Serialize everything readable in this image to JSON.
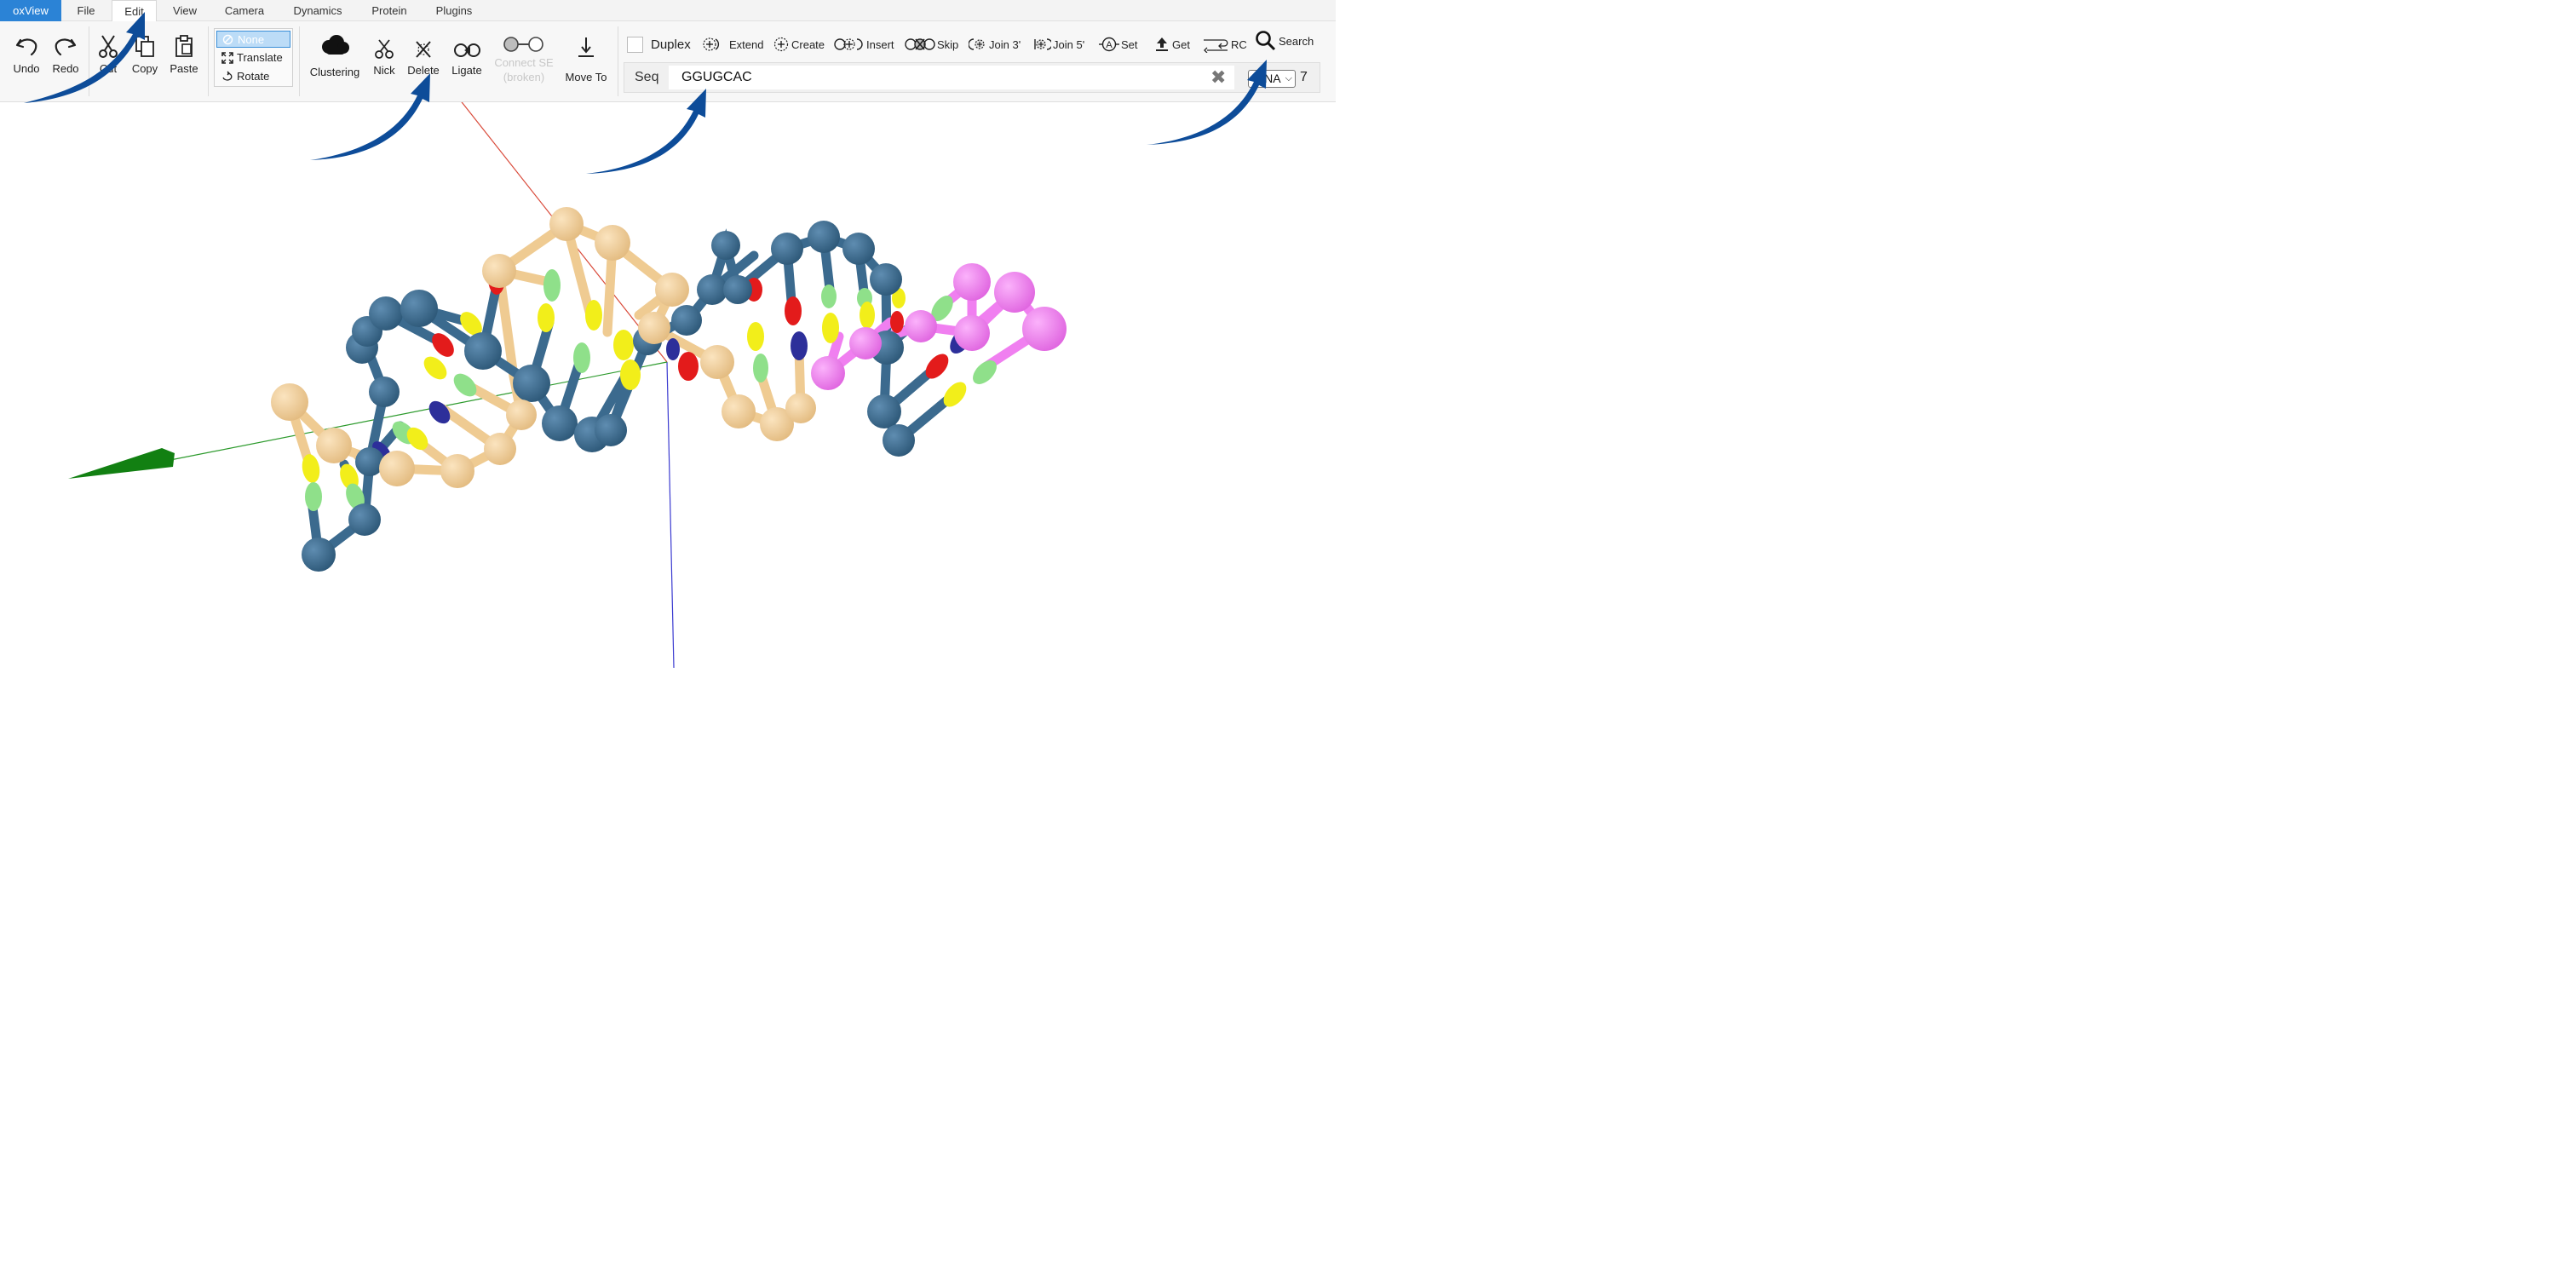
{
  "menubar": {
    "brand": "oxView",
    "items": [
      "File",
      "Edit",
      "View",
      "Camera",
      "Dynamics",
      "Protein",
      "Plugins"
    ],
    "active": "Edit"
  },
  "ribbon": {
    "history": {
      "undo": "Undo",
      "redo": "Redo"
    },
    "clipboard": {
      "cut": "Cut",
      "copy": "Copy",
      "paste": "Paste"
    },
    "transform": {
      "options": [
        "None",
        "Translate",
        "Rotate"
      ],
      "selected": "None"
    },
    "edit_tools": {
      "clustering": "Clustering",
      "nick": "Nick",
      "delete": "Delete",
      "ligate": "Ligate",
      "connect_se": "Connect SE",
      "connect_se_note": "(broken)",
      "move_to": "Move To"
    },
    "sequence_tools": {
      "duplex": "Duplex",
      "duplex_checked": false,
      "extend": "Extend",
      "create": "Create",
      "insert": "Insert",
      "skip": "Skip",
      "join3": "Join 3'",
      "join5": "Join 5'",
      "set": "Set",
      "get": "Get",
      "rc": "RC",
      "search": "Search"
    },
    "sequence": {
      "label": "Seq",
      "value": "GGUGCAC",
      "type_selected": "RNA",
      "count": "7"
    }
  },
  "colors": {
    "brand": "#2b83d6",
    "strand_blue": "#3b6a8e",
    "strand_tan": "#f2cf9a",
    "strand_pink": "#f07ff0",
    "base_A": "#f2ee1a",
    "base_G": "#8fe08a",
    "base_C": "#e31b1b",
    "base_U": "#2d2f9a",
    "arrow": "#0d4c99",
    "axis_x": "#d94a3a",
    "axis_y": "#2c9a2c",
    "axis_z": "#3a3ad0"
  },
  "icons": [
    "undo-icon",
    "redo-icon",
    "cut-icon",
    "copy-icon",
    "paste-icon",
    "cloud-icon",
    "nick-icon",
    "delete-icon",
    "ligate-icon",
    "connect-icon",
    "move-to-icon",
    "search-icon"
  ]
}
